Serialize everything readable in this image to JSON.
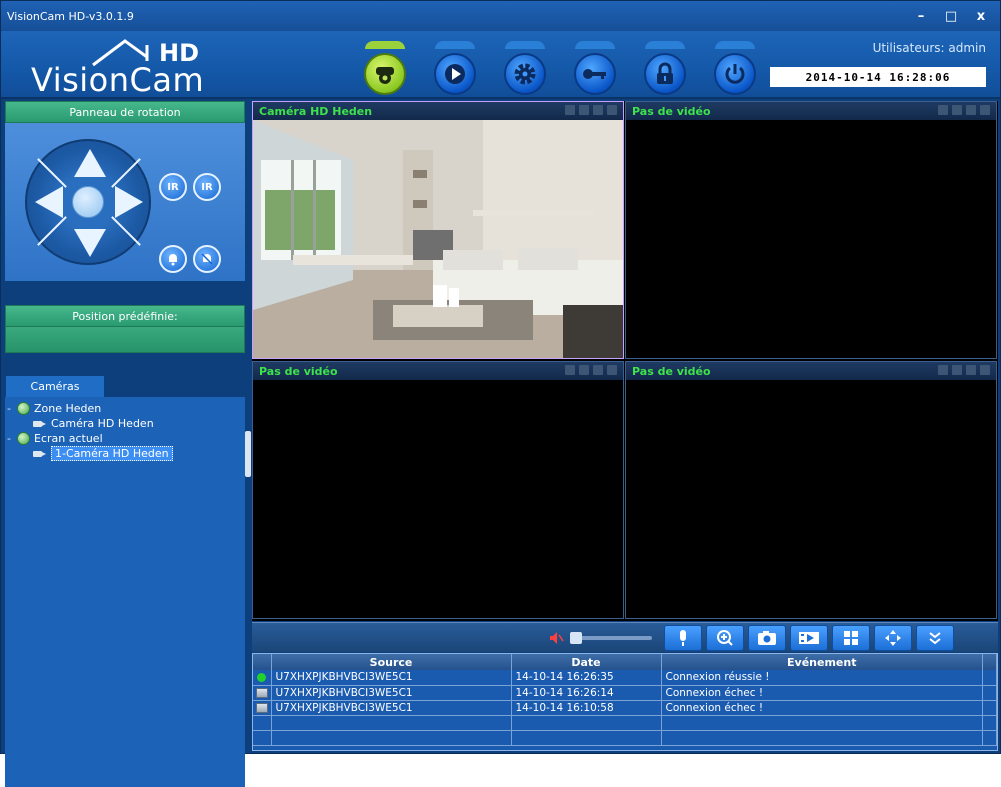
{
  "window": {
    "title": "VisionCam HD-v3.0.1.9"
  },
  "header": {
    "brand": "VisionCam",
    "brand_hd": "HD",
    "user_label": "Utilisateurs: admin",
    "datetime": "2014-10-14 16:28:06"
  },
  "toolbar": {
    "items": [
      {
        "icon": "camera-view-icon",
        "active": true
      },
      {
        "icon": "play-icon"
      },
      {
        "icon": "gear-icon"
      },
      {
        "icon": "key-icon"
      },
      {
        "icon": "lock-icon"
      },
      {
        "icon": "power-icon"
      }
    ]
  },
  "left": {
    "rotation_title": "Panneau de rotation",
    "ir_label": "IR",
    "preset_title": "Position prédéfinie:",
    "cameras_tab": "Caméras",
    "tree": {
      "zone": "Zone Heden",
      "zone_camera": "Caméra HD Heden",
      "screen": "Ecran actuel",
      "screen_camera": "1-Caméra HD Heden"
    }
  },
  "grid": {
    "cells": [
      {
        "title": "Caméra HD Heden"
      },
      {
        "title": "Pas de vidéo"
      },
      {
        "title": "Pas de vidéo"
      },
      {
        "title": "Pas de vidéo"
      }
    ]
  },
  "log": {
    "headers": {
      "source": "Source",
      "date": "Date",
      "event": "Evénement"
    },
    "rows": [
      {
        "status": "green",
        "source": "U7XHXPJKBHVBCI3WE5C1",
        "date": "14-10-14 16:26:35",
        "event": "Connexion réussie !"
      },
      {
        "status": "error",
        "source": "U7XHXPJKBHVBCI3WE5C1",
        "date": "14-10-14 16:26:14",
        "event": "Connexion échec !"
      },
      {
        "status": "error",
        "source": "U7XHXPJKBHVBCI3WE5C1",
        "date": "14-10-14 16:10:58",
        "event": "Connexion échec !"
      }
    ]
  },
  "colors": {
    "accent_blue": "#1f62b4",
    "panel_green": "#2a9a70",
    "video_title_green": "#3ee24b"
  }
}
